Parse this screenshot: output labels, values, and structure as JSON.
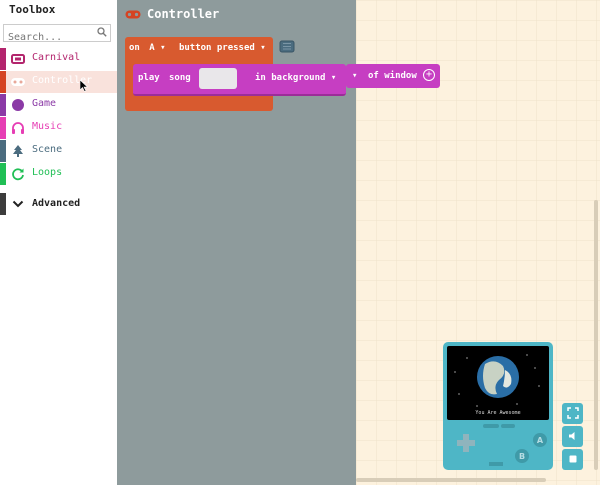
{
  "toolbox": {
    "title": "Toolbox",
    "search_placeholder": "Search...",
    "categories": [
      {
        "label": "Carnival",
        "color": "#b3256d",
        "icon": "ticket-icon"
      },
      {
        "label": "Controller",
        "color": "#d54322",
        "icon": "gamepad-icon"
      },
      {
        "label": "Game",
        "color": "#8b3aa6",
        "icon": "circle-icon"
      },
      {
        "label": "Music",
        "color": "#e63eb4",
        "icon": "headphones-icon"
      },
      {
        "label": "Scene",
        "color": "#4b6c7f",
        "icon": "tree-icon"
      },
      {
        "label": "Loops",
        "color": "#20bf55",
        "icon": "refresh-icon"
      },
      {
        "label": "Advanced",
        "color": "#3c3c3c",
        "icon": "chevron-down-icon"
      }
    ]
  },
  "flyout": {
    "title": "Controller"
  },
  "blocks": {
    "on_block": {
      "on": "on",
      "key": "A",
      "event": "button pressed"
    },
    "play_block": {
      "play": "play",
      "song": "song",
      "mode": "in background"
    },
    "window_block": {
      "text": "of window"
    }
  },
  "simulator": {
    "screen_text": "You Are Awesome"
  },
  "colors": {
    "controller": "#d54322",
    "music": "#c63ec2",
    "flyout_bg": "#8e9b9c",
    "workspace_bg": "#fdf2de",
    "simulator": "#4eb6c6"
  }
}
